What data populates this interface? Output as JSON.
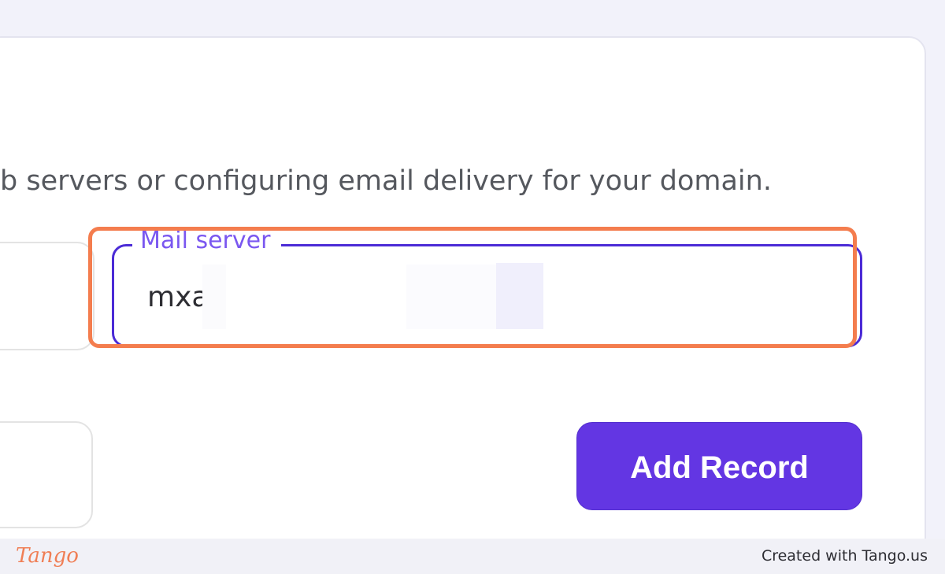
{
  "description_text": "b servers or configuring email delivery for your domain.",
  "mail_server": {
    "label": "Mail server",
    "value": "mxa"
  },
  "add_record_button": "Add Record",
  "footer": {
    "logo_text": "Tango",
    "credit_text": "Created with Tango.us"
  },
  "colors": {
    "accent": "#6336e3",
    "focus_border": "#4b2bd6",
    "highlight": "#f47d4e",
    "label": "#7a57f0"
  }
}
